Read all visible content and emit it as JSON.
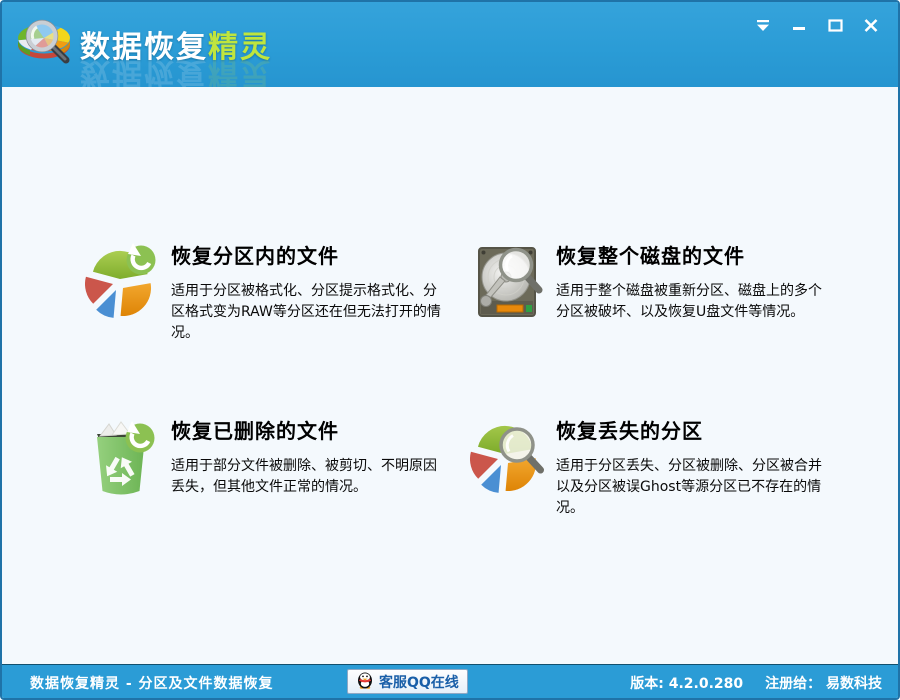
{
  "app": {
    "title_white": "数据恢复",
    "title_green": "精灵"
  },
  "header": {
    "logo_icon": "magnifier-pie-logo",
    "controls": [
      "pin-menu-icon",
      "minimize-icon",
      "maximize-icon",
      "close-icon"
    ]
  },
  "options": [
    {
      "icon": "pie-chart-refresh-icon",
      "title": "恢复分区内的文件",
      "description": "适用于分区被格式化、分区提示格式化、分区格式变为RAW等分区还在但无法打开的情况。"
    },
    {
      "icon": "hard-disk-magnifier-icon",
      "title": "恢复整个磁盘的文件",
      "description": "适用于整个磁盘被重新分区、磁盘上的多个分区被破坏、以及恢复U盘文件等情况。"
    },
    {
      "icon": "recycle-bin-refresh-icon",
      "title": "恢复已删除的文件",
      "description": "适用于部分文件被删除、被剪切、不明原因丢失，但其他文件正常的情况。"
    },
    {
      "icon": "pie-chart-magnifier-icon",
      "title": "恢复丢失的分区",
      "description": "适用于分区丢失、分区被删除、分区被合并以及分区被误Ghost等源分区已不存在的情况。"
    }
  ],
  "statusbar": {
    "left_text": "数据恢复精灵 - 分区及文件数据恢复",
    "qq_icon": "qq-penguin-icon",
    "qq_button_label": "客服QQ在线",
    "version_label": "版本:",
    "version_value": "4.2.0.280",
    "registered_label": "注册给：",
    "registered_value": "易数科技"
  },
  "colors": {
    "header_blue": "#2B9CD6",
    "statusbar_blue": "#2B9CD6",
    "main_bg": "#F4F9FD",
    "window_border": "#1F73A8",
    "title_green": "#BFE53E",
    "qq_text_blue": "#1A5FA8",
    "pie_green": "#93BE3B",
    "pie_red": "#CB564B",
    "pie_blue": "#4A8FD3",
    "pie_orange": "#E8900E",
    "badge_green": "#8CC152"
  }
}
